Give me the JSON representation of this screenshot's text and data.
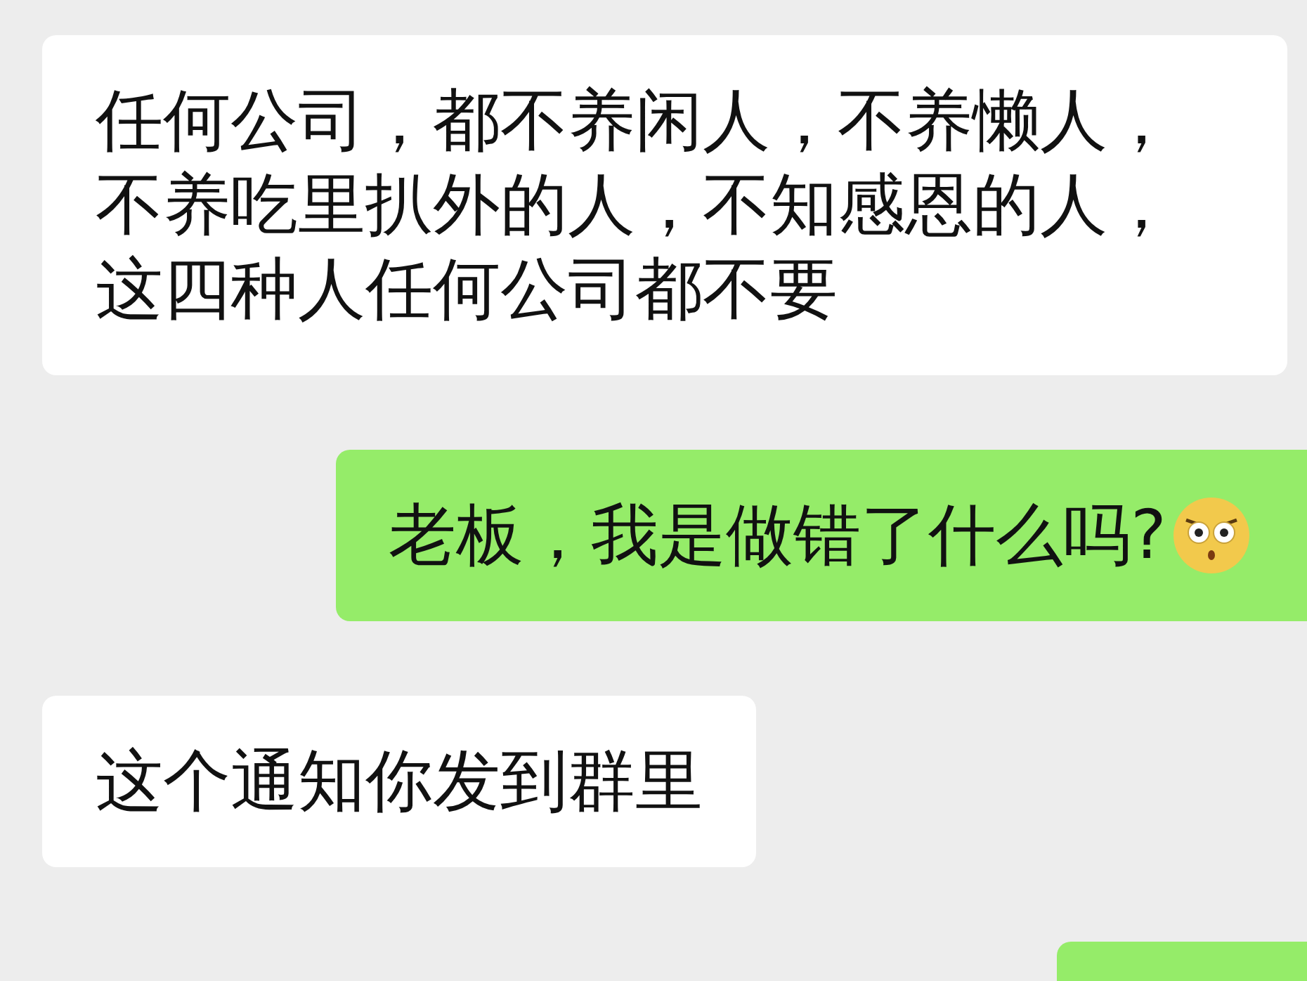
{
  "messages": [
    {
      "kind": "incoming",
      "text": "任何公司，都不养闲人，不养懒人，不养吃里扒外的人，不知感恩的人，这四种人任何公司都不要"
    },
    {
      "kind": "outgoing",
      "text": "老板，我是做错了什么吗?",
      "emoji": true
    },
    {
      "kind": "incoming",
      "text": "这个通知你发到群里"
    },
    {
      "kind": "outgoing"
    }
  ]
}
